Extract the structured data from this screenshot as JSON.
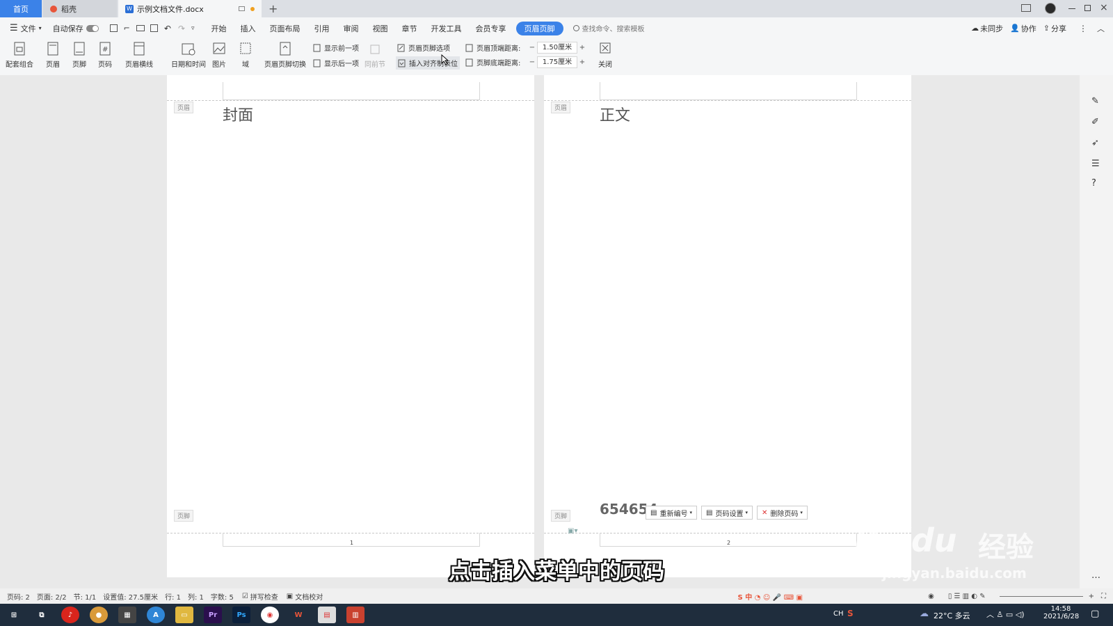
{
  "tabs": {
    "home": "首页",
    "daoke": "稻壳",
    "doc": "示例文档文件.docx"
  },
  "menu": {
    "file": "文件",
    "autosave": "自动保存",
    "items": [
      "开始",
      "插入",
      "页面布局",
      "引用",
      "审阅",
      "视图",
      "章节",
      "开发工具",
      "会员专享"
    ],
    "active": "页眉页脚",
    "search_placeholder": "查找命令、搜索模板",
    "right": {
      "sync": "未同步",
      "collab": "协作",
      "share": "分享"
    }
  },
  "ribbon": {
    "group_combo": "配套组合",
    "header": "页眉",
    "footer": "页脚",
    "page_num": "页码",
    "header_line": "页眉横线",
    "datetime": "日期和时间",
    "picture": "图片",
    "field": "域",
    "switch": "页眉页脚切换",
    "show_prev": "显示前一项",
    "show_next": "显示后一项",
    "same_prev": "同前节",
    "options": "页眉页脚选项",
    "insert_tab": "插入对齐制表位",
    "header_top_label": "页眉顶端距离:",
    "header_top_value": "1.50厘米",
    "footer_bottom_label": "页脚底端距离:",
    "footer_bottom_value": "1.75厘米",
    "close": "关闭"
  },
  "pages": [
    {
      "header_tag": "页眉",
      "title": "封面",
      "footer_tag": "页脚",
      "page_number": "1"
    },
    {
      "header_tag": "页眉",
      "title": "正文",
      "footer_tag": "页脚",
      "page_number": "2",
      "footer_text": "654654"
    }
  ],
  "footer_popup": {
    "renumber": "重新编号",
    "page_setup": "页码设置",
    "delete": "删除页码"
  },
  "status": {
    "page": "页码: 2",
    "pages": "页面: 2/2",
    "section": "节: 1/1",
    "setting": "设置值: 27.5厘米",
    "row": "行: 1",
    "col": "列: 1",
    "words": "字数: 5",
    "spell": "拼写检查",
    "proof": "文档校对"
  },
  "subtitle": "点击插入菜单中的页码",
  "watermark": {
    "brand": "Baidu",
    "cn": "经验",
    "url": "jingyan.baidu.com"
  },
  "taskbar": {
    "weather": "22°C 多云",
    "time": "14:58",
    "date": "2021/6/28",
    "ime": "CH"
  },
  "colors": {
    "accent": "#3b82e8",
    "taskbar": "#1f2d3d"
  }
}
